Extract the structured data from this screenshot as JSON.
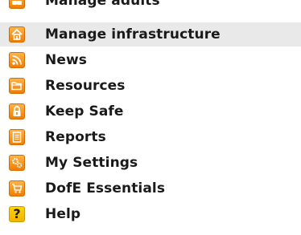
{
  "menu": {
    "items": [
      {
        "label": "Manage adults",
        "icon": "people-icon"
      },
      {
        "label": "Manage infrastructure",
        "icon": "house-icon"
      },
      {
        "label": "News",
        "icon": "rss-icon"
      },
      {
        "label": "Resources",
        "icon": "folder-icon"
      },
      {
        "label": "Keep Safe",
        "icon": "padlock-icon"
      },
      {
        "label": "Reports",
        "icon": "document-icon"
      },
      {
        "label": "My Settings",
        "icon": "cogs-icon"
      },
      {
        "label": "DofE Essentials",
        "icon": "cart-icon"
      },
      {
        "label": "Help",
        "icon": "question-icon",
        "glyph": "?"
      }
    ]
  },
  "colors": {
    "icon_orange": "#f07d00",
    "help_yellow": "#f0b400",
    "hover_row": "#e9e9e9",
    "text": "#1a1a1a"
  }
}
